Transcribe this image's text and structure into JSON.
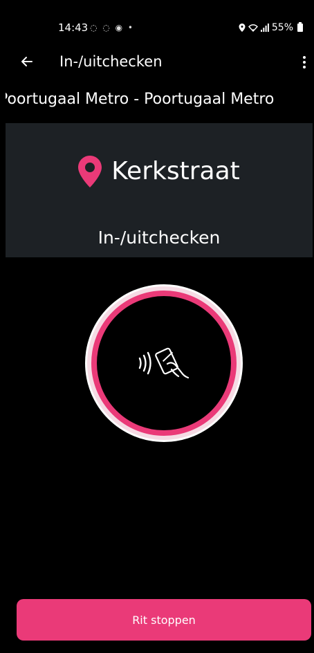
{
  "status_bar": {
    "time": "14:43",
    "left_icons": "◌ ◌ ◉ •",
    "battery_text": "55%"
  },
  "app_bar": {
    "title": "In-/uitchecken",
    "back_icon": "arrow-left",
    "menu_icon": "more-vertical"
  },
  "route": {
    "text": "Poortugaal Metro - Poortugaal Metro"
  },
  "station": {
    "name": "Kerkstraat",
    "pin_color": "#ea3a78",
    "checkin_label": "In-/uitchecken"
  },
  "nfc": {
    "icon": "contactless-card-tap-icon",
    "ring_color": "#ea3a78"
  },
  "actions": {
    "stop_label": "Rit stoppen"
  },
  "colors": {
    "accent": "#ea3a78",
    "panel": "#1d2125",
    "background": "#000000"
  }
}
